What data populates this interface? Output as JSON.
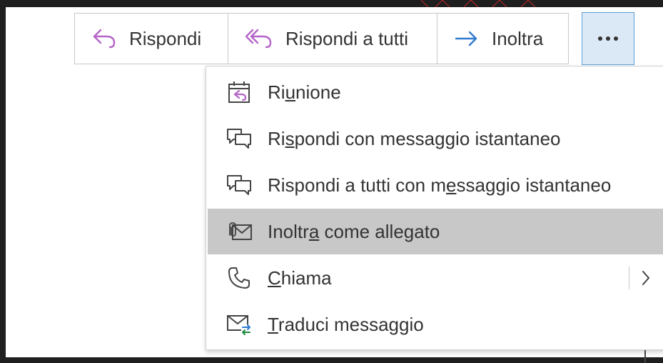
{
  "toolbar": {
    "reply_label": "Rispondi",
    "reply_all_label": "Rispondi a tutti",
    "forward_label": "Inoltra",
    "more_label": "•••"
  },
  "menu": {
    "items": [
      {
        "pre": "Ri",
        "key": "u",
        "post": "nione",
        "icon": "meeting-calendar-icon"
      },
      {
        "pre": "Ri",
        "key": "s",
        "post": "pondi con messaggio istantaneo",
        "icon": "instant-message-icon"
      },
      {
        "pre": "Rispondi a tutti con m",
        "key": "e",
        "post": "ssaggio istantaneo",
        "icon": "instant-message-icon"
      },
      {
        "pre": "Inoltr",
        "key": "a",
        "post": " come allegato",
        "icon": "forward-attachment-icon"
      },
      {
        "pre": "",
        "key": "C",
        "post": "hiama",
        "icon": "phone-icon"
      },
      {
        "pre": "",
        "key": "T",
        "post": "raduci messaggio",
        "icon": "translate-message-icon"
      }
    ],
    "submenu_arrow": "›"
  },
  "colors": {
    "reply_icon": "#b565c8",
    "forward_icon": "#2f7bd0",
    "hover_bg": "#c8c8c8",
    "more_button_bg": "#dbe9f6",
    "translate_accent": "#1d8a3c"
  }
}
